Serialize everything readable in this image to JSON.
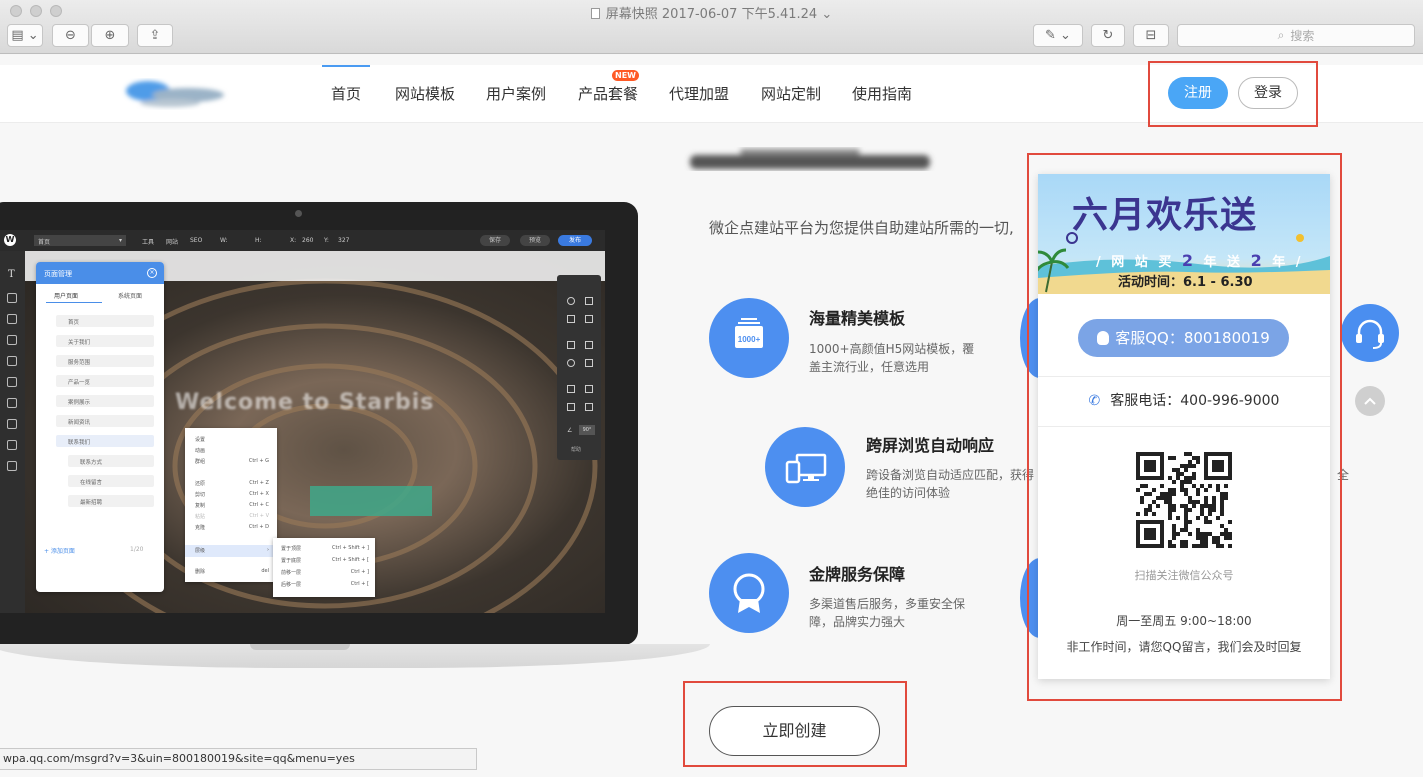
{
  "window": {
    "title": "屏幕快照 2017-06-07 下午5.41.24",
    "search_placeholder": "搜索"
  },
  "nav": {
    "items": [
      "首页",
      "网站模板",
      "用户案例",
      "产品套餐",
      "代理加盟",
      "网站定制",
      "使用指南"
    ],
    "new_badge": "NEW",
    "register": "注册",
    "login": "登录"
  },
  "editor": {
    "page_tab": "首页",
    "toolbar": [
      "工具",
      "网站",
      "SEO",
      "W:",
      "H:",
      "X:",
      "260",
      "Y:",
      "327"
    ],
    "save": "保存",
    "preview": "预览",
    "publish": "发布",
    "panel_title": "页面管理",
    "panel_tabs": [
      "用户页面",
      "系统页面"
    ],
    "pages": [
      "首页",
      "关于我们",
      "服务范围",
      "产品一览",
      "案例展示",
      "新闻资讯",
      "联系我们",
      "联系方式",
      "在线留言",
      "最新招聘"
    ],
    "add_page": "+ 添加页面",
    "page_count": "1/20",
    "welcome": "Welcome to Starbis",
    "context_menu": [
      {
        "label": "设置",
        "key": ""
      },
      {
        "label": "动画",
        "key": ""
      },
      {
        "label": "群组",
        "key": "Ctrl + G"
      },
      {
        "label": "还原",
        "key": "Ctrl + Z"
      },
      {
        "label": "剪切",
        "key": "Ctrl + X"
      },
      {
        "label": "复制",
        "key": "Ctrl + C"
      },
      {
        "label": "粘贴",
        "key": "Ctrl + V"
      },
      {
        "label": "克隆",
        "key": "Ctrl + D"
      },
      {
        "label": "层级",
        "key": "›"
      },
      {
        "label": "删除",
        "key": "del"
      }
    ],
    "submenu": [
      {
        "label": "置于顶层",
        "key": "Ctrl + Shift + ]"
      },
      {
        "label": "置于底层",
        "key": "Ctrl + Shift + ["
      },
      {
        "label": "前移一层",
        "key": "Ctrl + ]"
      },
      {
        "label": "后移一层",
        "key": "Ctrl + ["
      }
    ],
    "tools_angle": "90°",
    "tools_help": "帮助"
  },
  "main": {
    "description": "微企点建站平台为您提供自助建站所需的一切,",
    "features": [
      {
        "title": "海量精美模板",
        "text1": "1000+高颜值H5网站模板，覆",
        "text2": "盖主流行业，任意选用",
        "icon_label": "1000+"
      },
      {
        "title": "跨屏浏览自动响应",
        "text1": "跨设备浏览自动适应匹配，获得",
        "text2": "绝佳的访问体验",
        "trail": "全"
      },
      {
        "title": "金牌服务保障",
        "text1": "多渠道售后服务，多重安全保",
        "text2": "障，品牌实力强大"
      }
    ],
    "create_button": "立即创建"
  },
  "popup": {
    "banner_title": "六月欢乐送",
    "banner_sub_pre": "/ 网 站 买",
    "banner_sub_n1": "2",
    "banner_sub_mid": "年 送",
    "banner_sub_n2": "2",
    "banner_sub_post": "年 /",
    "banner_period": "活动时间：6.1 - 6.30",
    "qq_button": "客服QQ：800180019",
    "phone": "客服电话：400-996-9000",
    "qr_caption": "扫描关注微信公众号",
    "hours": "周一至周五 9:00~18:00",
    "off_hours": "非工作时间，请您QQ留言，我们会及时回复"
  },
  "status_url": "wpa.qq.com/msgrd?v=3&uin=800180019&site=qq&menu=yes",
  "colors": {
    "accent": "#4a8ef0",
    "annotation": "#e14a3d",
    "register": "#4aa6f6"
  }
}
